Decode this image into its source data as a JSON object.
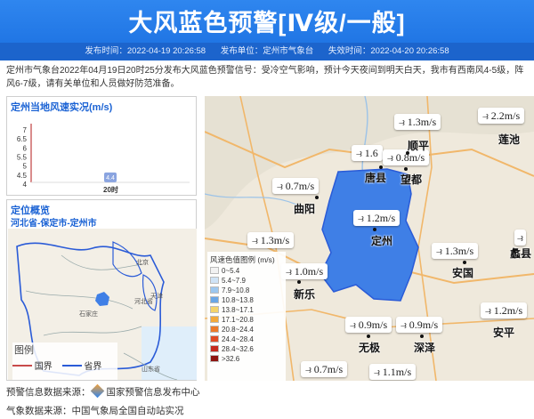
{
  "header": {
    "title": "大风蓝色预警[Ⅳ级/一般]",
    "issue_time": "发布时间：2022-04-19 20:26:58",
    "issuer": "发布单位：定州市气象台",
    "expire": "失效时间：2022-04-20 20:26:58"
  },
  "description": "定州市气象台2022年04月19日20时25分发布大风蓝色预警信号：受冷空气影响，预计今天夜间到明天白天，我市有西南风4-5级，阵风6-7级，请有关单位和人员做好防范准备。",
  "wind_panel": {
    "title": "定州当地风速实况(m/s)",
    "y_ticks": [
      "7",
      "6.5",
      "6",
      "5.5",
      "5",
      "4.5",
      "4"
    ],
    "point_label": "4.4",
    "x_label": "20时"
  },
  "chart_data": {
    "type": "scatter",
    "title": "定州当地风速实况(m/s)",
    "x": [
      "20时"
    ],
    "values": [
      4.4
    ],
    "ylim": [
      4,
      7
    ]
  },
  "location_panel": {
    "title": "定位概览",
    "path": "河北省-保定市-定州市",
    "mini_labels": [
      "北京",
      "天津",
      "河北省",
      "石家庄",
      "山东省"
    ],
    "legend_title": "图例",
    "legend_items": [
      "国界",
      "省界"
    ]
  },
  "colors": {
    "header": "#2f86ef",
    "warning_area": "#3f7fe6",
    "country_border": "#c84a4a",
    "province_border": "#2a5bd7"
  },
  "map": {
    "cities": [
      "顺平",
      "唐县",
      "望都",
      "曲阳",
      "定州",
      "安国",
      "新乐",
      "无极",
      "深泽",
      "安平",
      "莲池",
      "蠡县"
    ],
    "wind_labels": [
      "1.3m/s",
      "2.2m/s",
      "1.6",
      "0.8m/s",
      "0.7m/s",
      "1.2m/s",
      "1.3m/s",
      "1.3m/s",
      "1.0m/s",
      "1.2m/s",
      "0.9m/s",
      "0.9m/s",
      "0.7m/s",
      "1.1m/s"
    ],
    "scale_title": "风速色值图例 (m/s)",
    "scale": [
      {
        "label": "0~5.4",
        "color": "#f2f2f2"
      },
      {
        "label": "5.4~7.9",
        "color": "#cfe3f6"
      },
      {
        "label": "7.9~10.8",
        "color": "#9cc7ef"
      },
      {
        "label": "10.8~13.8",
        "color": "#6aa6e6"
      },
      {
        "label": "13.8~17.1",
        "color": "#f4d36b"
      },
      {
        "label": "17.1~20.8",
        "color": "#f3a93c"
      },
      {
        "label": "20.8~24.4",
        "color": "#ec7a2a"
      },
      {
        "label": "24.4~28.4",
        "color": "#e04b24"
      },
      {
        "label": "28.4~32.6",
        "color": "#c52a1e"
      },
      {
        "label": ">32.6",
        "color": "#8e1410"
      }
    ]
  },
  "footer": {
    "warning_source": "预警信息数据来源：",
    "warning_source_name": "国家预警信息发布中心",
    "weather_source": "气象数据来源：中国气象局全国自动站实况"
  }
}
